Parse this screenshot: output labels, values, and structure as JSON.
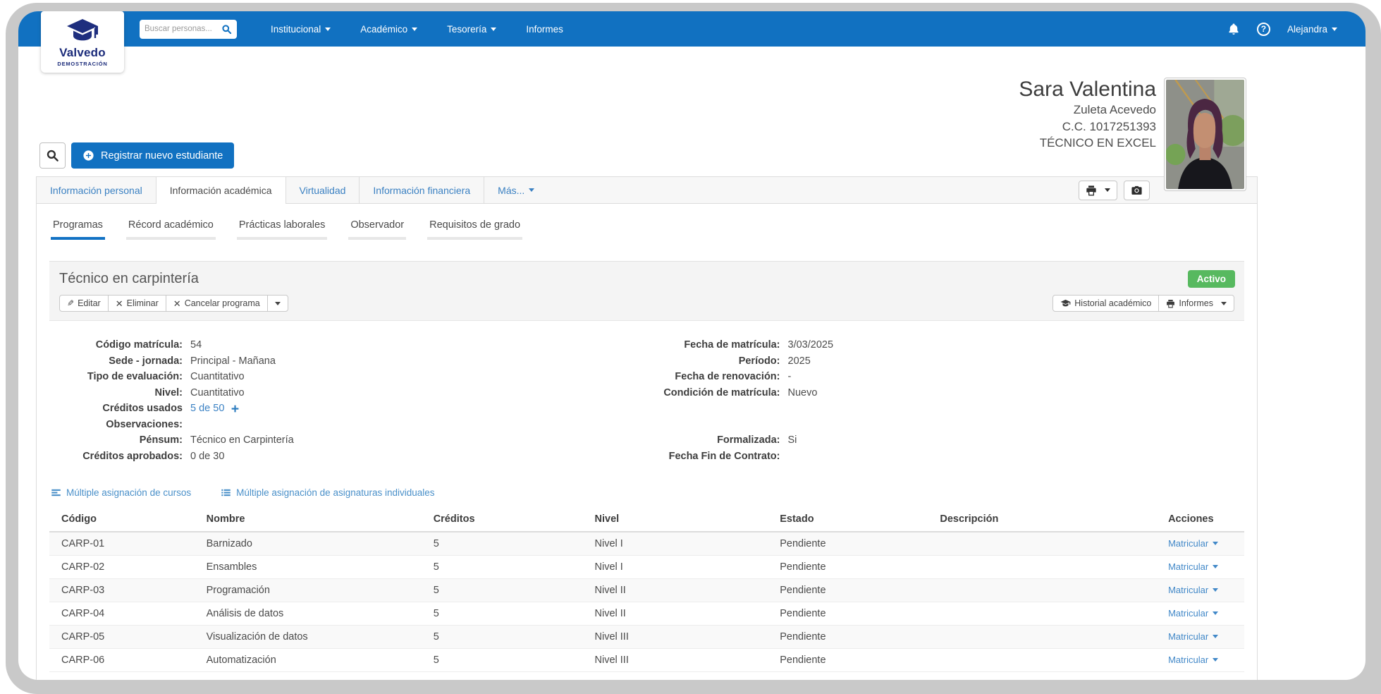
{
  "colors": {
    "accent_blue": "#1171c1",
    "badge_green": "#57b95f",
    "link_blue": "#3f8ac6",
    "brand_navy": "#1b2b7a"
  },
  "brand": {
    "name": "Valvedo",
    "tagline": "DEMOSTRACIÓN"
  },
  "navbar": {
    "search_placeholder": "Buscar personas...",
    "menu": [
      {
        "label": "Institucional"
      },
      {
        "label": "Académico"
      },
      {
        "label": "Tesorería"
      },
      {
        "label": "Informes"
      }
    ],
    "user": "Alejandra"
  },
  "student": {
    "name": "Sara Valentina",
    "surname": "Zuleta Acevedo",
    "document": "C.C. 1017251393",
    "program_label": "TÉCNICO EN EXCEL"
  },
  "toolbar": {
    "register_label": "Registrar nuevo estudiante"
  },
  "tabs": [
    {
      "label": "Información personal"
    },
    {
      "label": "Información académica"
    },
    {
      "label": "Virtualidad"
    },
    {
      "label": "Información financiera"
    },
    {
      "label": "Más..."
    }
  ],
  "subtabs": [
    {
      "label": "Programas"
    },
    {
      "label": "Récord académico"
    },
    {
      "label": "Prácticas laborales"
    },
    {
      "label": "Observador"
    },
    {
      "label": "Requisitos de grado"
    }
  ],
  "program": {
    "title": "Técnico en carpintería",
    "status": "Activo",
    "actions": {
      "edit": "Editar",
      "remove": "Eliminar",
      "cancel": "Cancelar programa",
      "history": "Historial académico",
      "reports": "Informes"
    },
    "details_left": [
      {
        "label": "Código matrícula:",
        "value": "54"
      },
      {
        "label": "Sede - jornada:",
        "value": "Principal - Mañana"
      },
      {
        "label": "Tipo de evaluación:",
        "value": "Cuantitativo"
      },
      {
        "label": "Nivel:",
        "value": "Cuantitativo"
      },
      {
        "label": "Créditos usados",
        "value": "5 de 50"
      },
      {
        "label": "Observaciones:",
        "value": ""
      },
      {
        "label": "Pénsum:",
        "value": "Técnico en Carpintería"
      },
      {
        "label": "Créditos aprobados:",
        "value": "0 de 30"
      }
    ],
    "details_right": [
      {
        "label": "Fecha de matrícula:",
        "value": "3/03/2025"
      },
      {
        "label": "Período:",
        "value": "2025"
      },
      {
        "label": "Fecha de renovación:",
        "value": "-"
      },
      {
        "label": "Condición de matrícula:",
        "value": "Nuevo"
      },
      {
        "label": "",
        "value": ""
      },
      {
        "label": "",
        "value": ""
      },
      {
        "label": "Formalizada:",
        "value": "Si"
      },
      {
        "label": "Fecha Fin de Contrato:",
        "value": ""
      }
    ]
  },
  "assign_links": [
    {
      "label": "Múltiple asignación de cursos"
    },
    {
      "label": "Múltiple asignación de asignaturas individuales"
    }
  ],
  "courses_table": {
    "headers": [
      "Código",
      "Nombre",
      "Créditos",
      "Nivel",
      "Estado",
      "Descripción",
      "Acciones"
    ],
    "action_label": "Matricular",
    "rows": [
      {
        "codigo": "CARP-01",
        "nombre": "Barnizado",
        "creditos": "5",
        "nivel": "Nivel I",
        "estado": "Pendiente",
        "descripcion": ""
      },
      {
        "codigo": "CARP-02",
        "nombre": "Ensambles",
        "creditos": "5",
        "nivel": "Nivel I",
        "estado": "Pendiente",
        "descripcion": ""
      },
      {
        "codigo": "CARP-03",
        "nombre": "Programación",
        "creditos": "5",
        "nivel": "Nivel II",
        "estado": "Pendiente",
        "descripcion": ""
      },
      {
        "codigo": "CARP-04",
        "nombre": "Análisis de datos",
        "creditos": "5",
        "nivel": "Nivel II",
        "estado": "Pendiente",
        "descripcion": ""
      },
      {
        "codigo": "CARP-05",
        "nombre": "Visualización de datos",
        "creditos": "5",
        "nivel": "Nivel III",
        "estado": "Pendiente",
        "descripcion": ""
      },
      {
        "codigo": "CARP-06",
        "nombre": "Automatización",
        "creditos": "5",
        "nivel": "Nivel III",
        "estado": "Pendiente",
        "descripcion": ""
      }
    ]
  }
}
